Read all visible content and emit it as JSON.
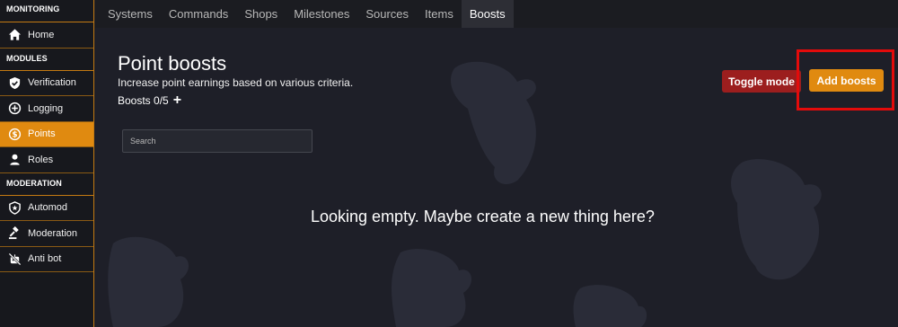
{
  "sidebar": {
    "sections": [
      {
        "title": "MONITORING",
        "items": [
          {
            "label": "Home",
            "icon": "home-icon"
          }
        ]
      },
      {
        "title": "MODULES",
        "items": [
          {
            "label": "Verification",
            "icon": "shield-check-icon"
          },
          {
            "label": "Logging",
            "icon": "plus-circle-icon"
          },
          {
            "label": "Points",
            "icon": "dollar-circle-icon",
            "active": true
          },
          {
            "label": "Roles",
            "icon": "user-icon"
          }
        ]
      },
      {
        "title": "MODERATION",
        "items": [
          {
            "label": "Automod",
            "icon": "shield-star-icon"
          },
          {
            "label": "Moderation",
            "icon": "gavel-icon"
          },
          {
            "label": "Anti bot",
            "icon": "robot-slash-icon"
          }
        ]
      }
    ]
  },
  "tabs": [
    "Systems",
    "Commands",
    "Shops",
    "Milestones",
    "Sources",
    "Items",
    "Boosts"
  ],
  "active_tab": "Boosts",
  "main": {
    "title": "Point boosts",
    "subtitle": "Increase point earnings based on various criteria.",
    "count": "Boosts 0/5",
    "search_placeholder": "Search",
    "toggle_label": "Toggle mode",
    "add_label": "Add boosts",
    "empty_message": "Looking empty. Maybe create a new thing here?"
  },
  "colors": {
    "accent": "#e08a10",
    "danger": "#9c1e1e",
    "highlight": "#e30b0b",
    "background": "#1e1f28"
  }
}
